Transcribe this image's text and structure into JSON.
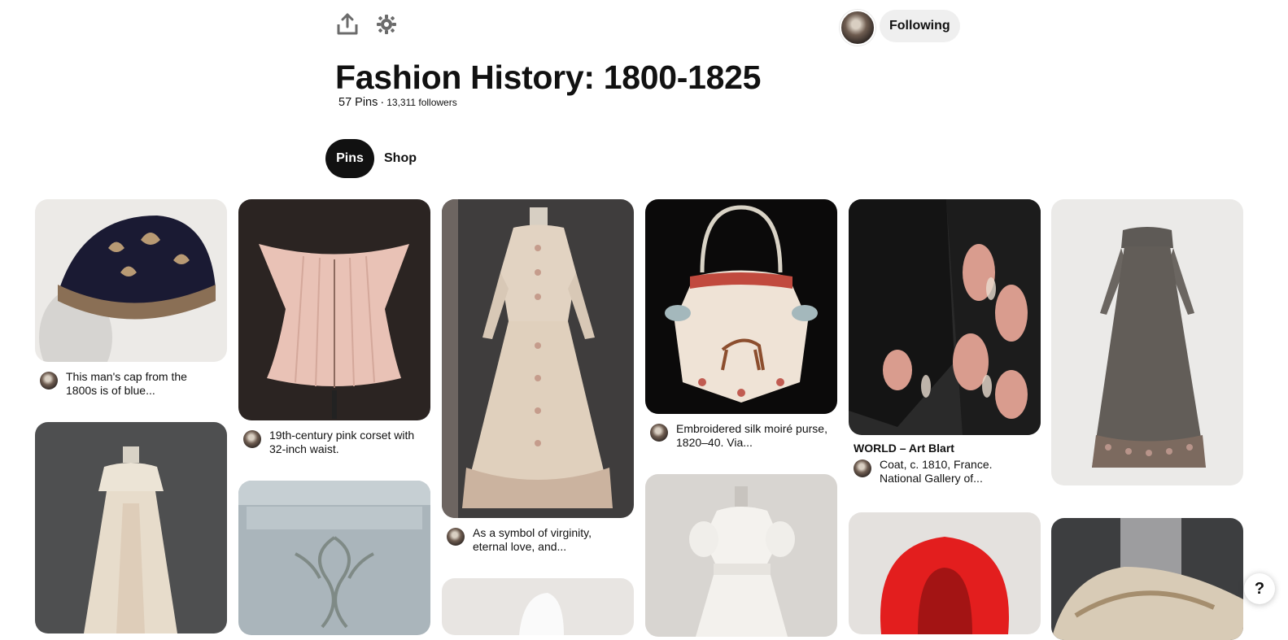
{
  "header": {
    "share_icon": "share-upload-icon",
    "settings_icon": "gear-icon",
    "follow_label": "Following"
  },
  "board": {
    "title": "Fashion History: 1800-1825",
    "pins_count": "57 Pins",
    "followers": "13,311 followers"
  },
  "tabs": [
    {
      "label": "Pins",
      "active": true
    },
    {
      "label": "Shop",
      "active": false
    }
  ],
  "pins": [
    {
      "description": "This man's cap from the 1800s is of blue..."
    },
    {
      "description": "19th-century pink corset with 32-inch waist."
    },
    {
      "description": "As a symbol of virginity, eternal love, and..."
    },
    {
      "description": "Embroidered silk moiré purse, 1820–40. Via..."
    },
    {
      "source": "WORLD – Art Blart",
      "description": "Coat, c. 1810, France. National Gallery of..."
    }
  ],
  "help": {
    "label": "?"
  }
}
